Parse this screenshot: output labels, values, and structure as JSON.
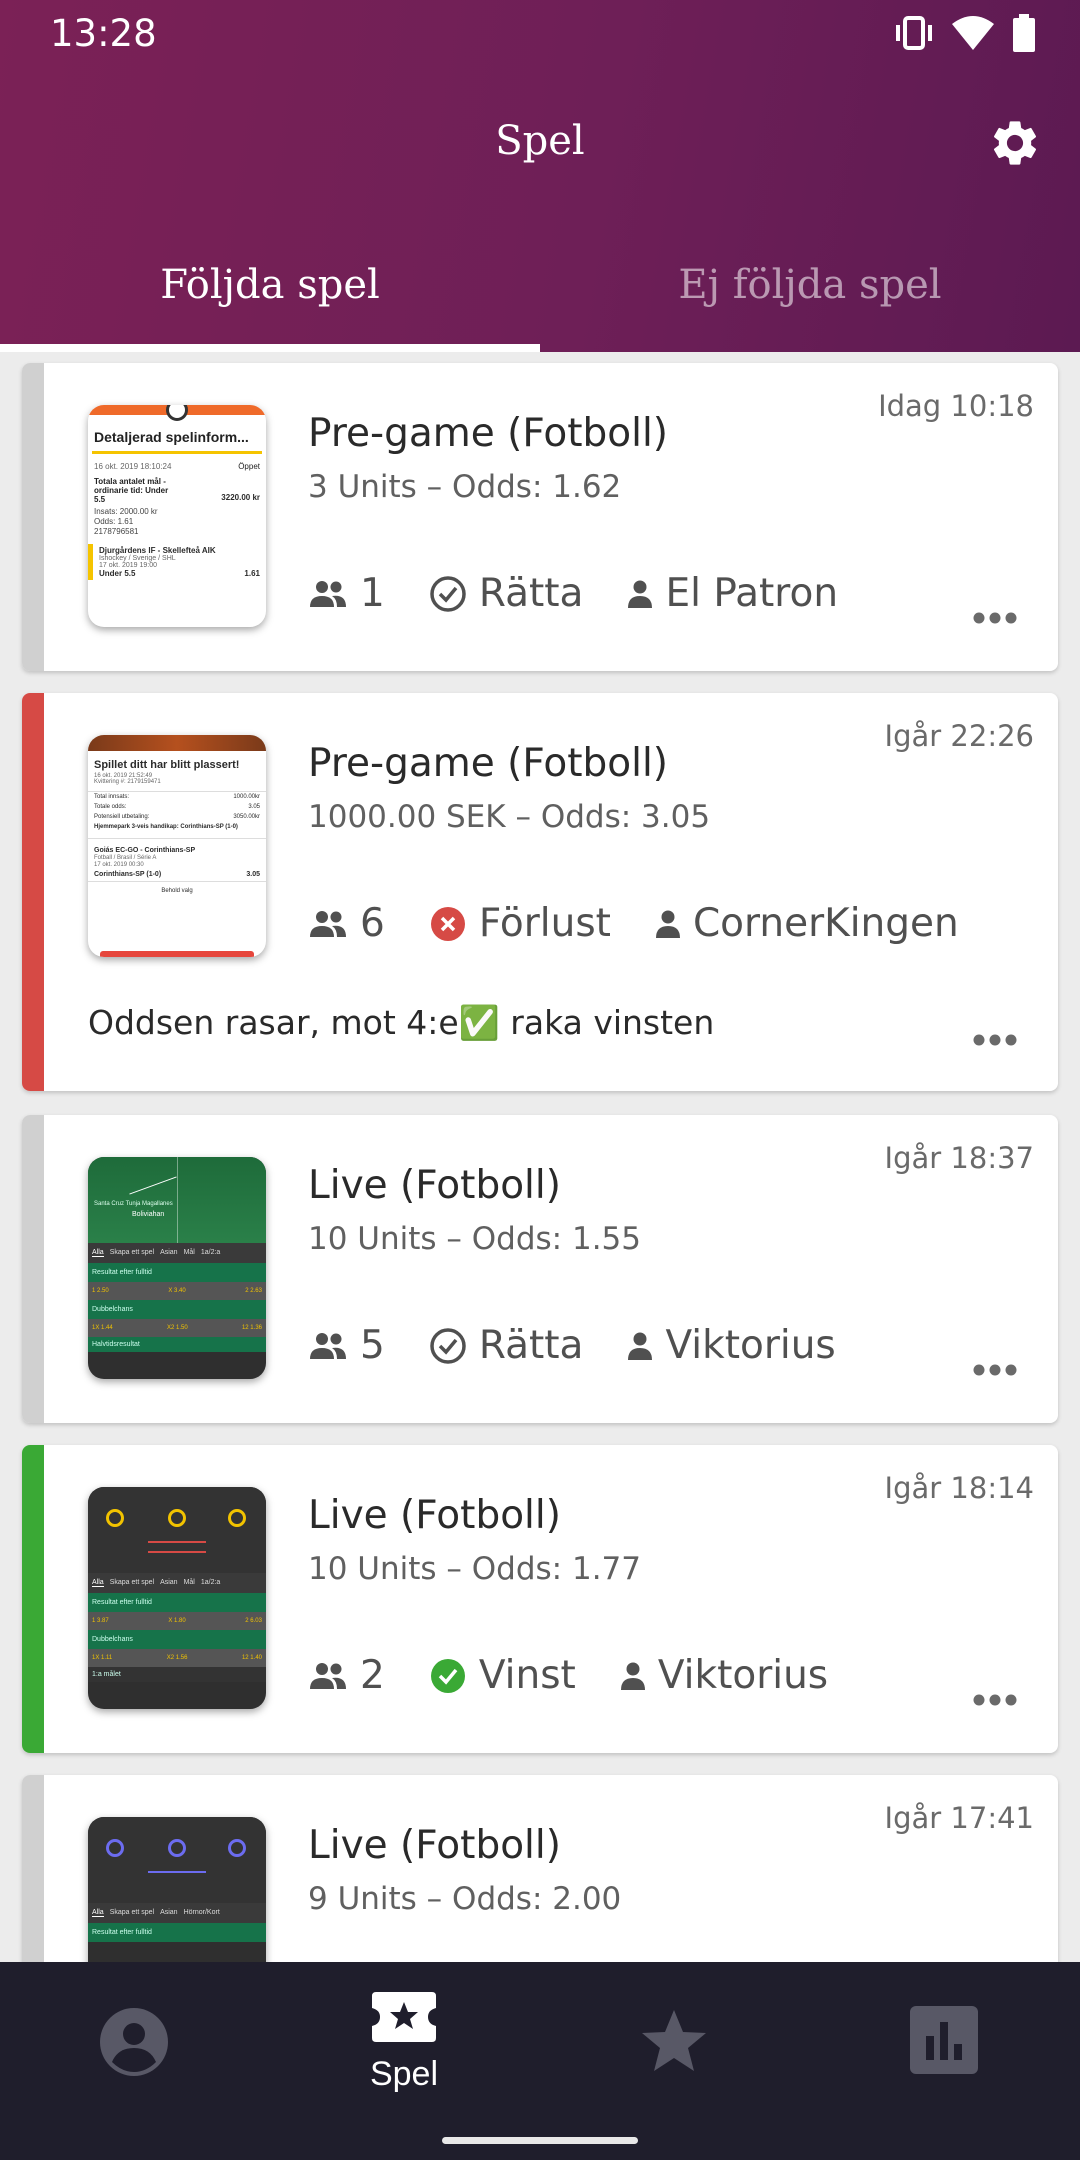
{
  "status_bar": {
    "time": "13:28"
  },
  "header": {
    "title": "Spel"
  },
  "tabs": [
    {
      "label": "Följda spel",
      "active": true
    },
    {
      "label": "Ej följda spel",
      "active": false
    }
  ],
  "cards": [
    {
      "time": "Idag 10:18",
      "title": "Pre-game (Fotboll)",
      "subtitle": "3 Units – Odds: 1.62",
      "followers": "1",
      "result": "Rätta",
      "user": "El Patron",
      "stripe_color": "#d0d0d0",
      "comment": "",
      "thumb": {
        "heading": "Detaljerad spelinform...",
        "line1": "16 okt. 2019 18:10:24",
        "status": "Öppet",
        "line2": "Totala antalet mål - ordinarie tid: Under 5.5",
        "amount": "3220.00 kr",
        "line3": "Insats: 2000.00 kr",
        "line4": "Odds: 1.61",
        "line5": "2178796581",
        "match": "Djurgårdens IF - Skellefteå AIK",
        "league": "Ishockey / Sverige / SHL",
        "date": "17 okt. 2019 19:00",
        "bet": "Under 5.5",
        "odds": "1.61"
      }
    },
    {
      "time": "Igår 22:26",
      "title": "Pre-game (Fotboll)",
      "subtitle": "1000.00 SEK – Odds: 3.05",
      "followers": "6",
      "result": "Förlust",
      "user": "CornerKingen",
      "stripe_color": "#d64a45",
      "comment": "Oddsen rasar, mot 4:e✅ raka vinsten",
      "thumb": {
        "heading": "Spillet ditt har blitt plassert!",
        "line1": "16 okt. 2019 21:52:49",
        "line2": "Kvittering #: 2179159471",
        "total": "1000.00kr",
        "odds_total": "3.05",
        "payout": "3050.00kr",
        "bet": "Hjemmepark 3-veis handikap: Corinthians-SP (1-0)",
        "match": "Goiás EC-GO - Corinthians-SP",
        "league": "Fotball / Brasil / Série A",
        "date": "17 okt. 2019 00:30",
        "pick": "Corinthians-SP (1-0)",
        "odds": "3.05",
        "keep": "Behold valg"
      }
    },
    {
      "time": "Igår 18:37",
      "title": "Live (Fotboll)",
      "subtitle": "10 Units – Odds: 1.55",
      "followers": "5",
      "result": "Rätta",
      "user": "Viktorius",
      "stripe_color": "#d0d0d0",
      "comment": "",
      "thumb": {
        "team": "Santa Cruz Tunja Magallanes",
        "team2": "Boliviahan",
        "tab1": "Alla",
        "tab2": "Skapa ett spel",
        "tab3": "Asian",
        "tab4": "Mål",
        "tab5": "1a/2:a",
        "section1": "Resultat efter fulltid",
        "o1": "1 2.50",
        "o2": "X 3.40",
        "o3": "2 2.63",
        "section2": "Dubbelchans",
        "d1": "1X 1.44",
        "d2": "X2 1.50",
        "d3": "12 1.36",
        "section3": "Halvtidsresultat"
      }
    },
    {
      "time": "Igår 18:14",
      "title": "Live (Fotboll)",
      "subtitle": "10 Units – Odds: 1.77",
      "followers": "2",
      "result": "Vinst",
      "user": "Viktorius",
      "stripe_color": "#3aa935",
      "comment": "",
      "thumb": {
        "tab1": "Alla",
        "tab2": "Skapa ett spel",
        "tab3": "Asian",
        "tab4": "Mål",
        "tab5": "1a/2:a",
        "section1": "Resultat efter fulltid",
        "o1": "1 3.87",
        "o2": "X 1.80",
        "o3": "2 6.03",
        "section2": "Dubbelchans",
        "d1": "1X 1.11",
        "d2": "X2 1.56",
        "d3": "12 1.40",
        "section3": "1:a målet"
      }
    },
    {
      "time": "Igår 17:41",
      "title": "Live (Fotboll)",
      "subtitle": "9 Units – Odds: 2.00",
      "followers": "",
      "result": "",
      "user": "",
      "stripe_color": "#d0d0d0",
      "comment": "",
      "thumb": {
        "tab1": "Alla",
        "tab2": "Skapa ett spel",
        "tab3": "Asian",
        "tab4": "Hörnor/Kort",
        "section1": "Resultat efter fulltid"
      }
    }
  ],
  "bottom_nav": [
    {
      "icon": "profile-icon",
      "label": "",
      "active": false
    },
    {
      "icon": "ticket-star-icon",
      "label": "Spel",
      "active": true
    },
    {
      "icon": "star-icon",
      "label": "",
      "active": false
    },
    {
      "icon": "stats-icon",
      "label": "",
      "active": false
    }
  ],
  "colors": {
    "header": "#7b2156",
    "loss": "#d64a45",
    "win": "#3aa935",
    "neutral": "#d0d0d0",
    "bottom_bar": "#1f1e2c"
  }
}
